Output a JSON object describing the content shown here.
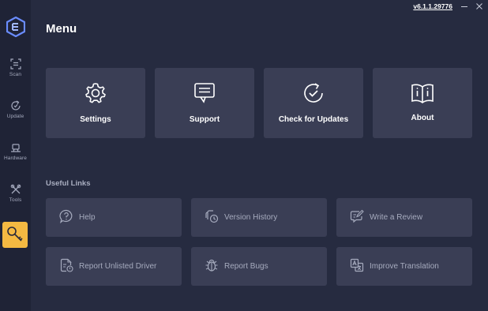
{
  "app": {
    "version": "v6.1.1.29776"
  },
  "sidebar": {
    "items": [
      {
        "label": "Scan",
        "icon": "scan-icon"
      },
      {
        "label": "Update",
        "icon": "update-icon"
      },
      {
        "label": "Hardware",
        "icon": "hardware-icon"
      },
      {
        "label": "Tools",
        "icon": "tools-icon"
      },
      {
        "label": "",
        "icon": "key-icon",
        "active": true
      }
    ]
  },
  "page": {
    "title": "Menu"
  },
  "menu_cards": [
    {
      "label": "Settings",
      "icon": "gear-icon"
    },
    {
      "label": "Support",
      "icon": "chat-icon"
    },
    {
      "label": "Check for Updates",
      "icon": "check-update-icon"
    },
    {
      "label": "About",
      "icon": "book-info-icon"
    }
  ],
  "useful_links": {
    "title": "Useful Links",
    "items": [
      {
        "label": "Help",
        "icon": "help-icon"
      },
      {
        "label": "Version History",
        "icon": "version-history-icon"
      },
      {
        "label": "Write a Review",
        "icon": "review-icon"
      },
      {
        "label": "Report Unlisted Driver",
        "icon": "report-driver-icon"
      },
      {
        "label": "Report Bugs",
        "icon": "bug-icon"
      },
      {
        "label": "Improve Translation",
        "icon": "translation-icon"
      }
    ]
  },
  "colors": {
    "background": "#262b40",
    "sidebar": "#1f2336",
    "card": "#3a3e55",
    "accent": "#f4b942",
    "logo": "#6a8cff"
  }
}
